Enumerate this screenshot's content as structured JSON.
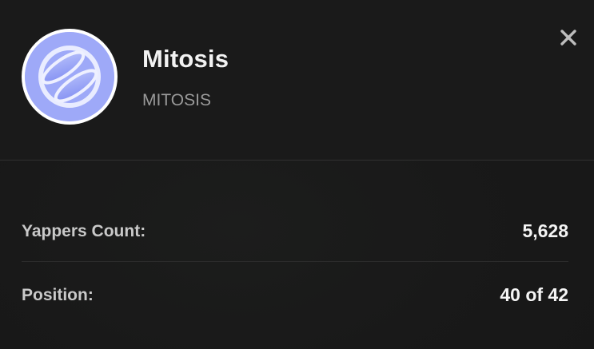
{
  "token": {
    "name": "Mitosis",
    "symbol": "MITOSIS",
    "avatar_icon": "mitosis-logo-icon",
    "avatar_color": "#9ea9f8"
  },
  "close_icon": "close-icon",
  "stats": {
    "yappers_label": "Yappers Count:",
    "yappers_value": "5,628",
    "position_label": "Position:",
    "position_value": "40 of 42"
  }
}
